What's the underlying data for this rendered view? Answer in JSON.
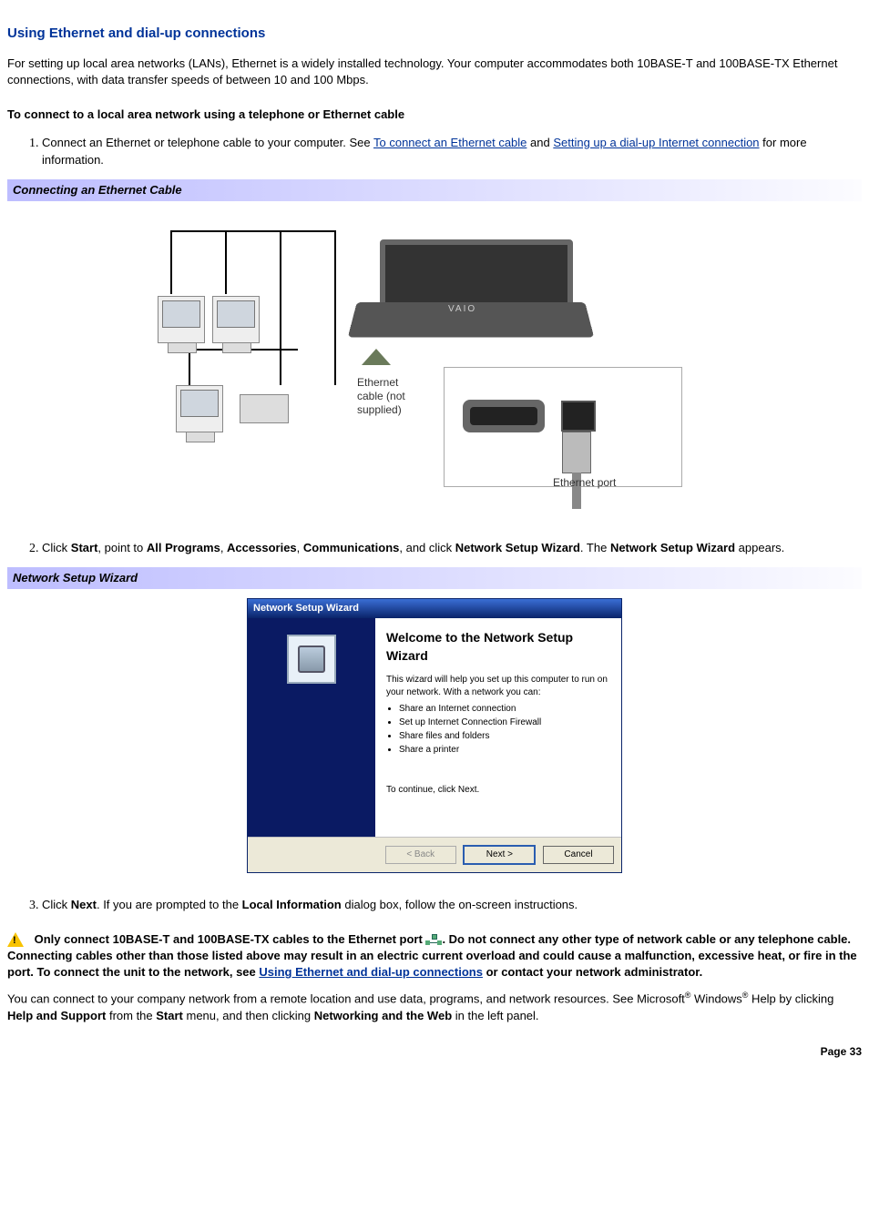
{
  "title": "Using Ethernet and dial-up connections",
  "intro": "For setting up local area networks (LANs), Ethernet is a widely installed technology. Your computer accommodates both 10BASE-T and 100BASE-TX Ethernet connections, with data transfer speeds of between 10 and 100 Mbps.",
  "subhead": "To connect to a local area network using a telephone or Ethernet cable",
  "step1": {
    "pre": "Connect an Ethernet or telephone cable to your computer. See ",
    "link1": "To connect an Ethernet cable",
    "mid": " and ",
    "link2": "Setting up a dial-up Internet connection",
    "post": " for more information."
  },
  "caption1": "Connecting an Ethernet Cable",
  "fig1": {
    "cable_label": "Ethernet\ncable (not\nsupplied)",
    "port_label": "Ethernet port",
    "laptop_logo": "VAIO"
  },
  "step2": {
    "t1": "Click ",
    "b1": "Start",
    "t2": ", point to ",
    "b2": "All Programs",
    "t3": ", ",
    "b3": "Accessories",
    "t4": ", ",
    "b4": "Communications",
    "t5": ", and click ",
    "b5": "Network Setup Wizard",
    "t6": ". The ",
    "b6": "Network Setup Wizard",
    "t7": " appears."
  },
  "caption2": "Network Setup Wizard",
  "wizard": {
    "titlebar": "Network Setup Wizard",
    "heading": "Welcome to the Network Setup Wizard",
    "desc": "This wizard will help you set up this computer to run on your network. With a network you can:",
    "bullets": [
      "Share an Internet connection",
      "Set up Internet Connection Firewall",
      "Share files and folders",
      "Share a printer"
    ],
    "continue": "To continue, click Next.",
    "btn_back": "< Back",
    "btn_next": "Next >",
    "btn_cancel": "Cancel"
  },
  "step3": {
    "t1": "Click ",
    "b1": "Next",
    "t2": ". If you are prompted to the ",
    "b2": "Local Information",
    "t3": " dialog box, follow the on-screen instructions."
  },
  "warning": {
    "t1": "Only connect 10BASE-T and 100BASE-TX cables to the Ethernet port ",
    "t2": ". Do not connect any other type of network cable or any telephone cable. Connecting cables other than those listed above may result in an electric current overload and could cause a malfunction, excessive heat, or fire in the port. To connect the unit to the network, see ",
    "link": "Using Ethernet and dial-up connections",
    "t3": " or contact your network administrator."
  },
  "closing": {
    "t1": "You can connect to your company network from a remote location and use data, programs, and network resources. See Microsoft",
    "reg1": "®",
    "t2": " Windows",
    "reg2": "®",
    "t3": " Help by clicking ",
    "b1": "Help and Support",
    "t4": " from the ",
    "b2": "Start",
    "t5": " menu, and then clicking ",
    "b3": "Networking and the Web",
    "t6": " in the left panel."
  },
  "page": "Page 33"
}
